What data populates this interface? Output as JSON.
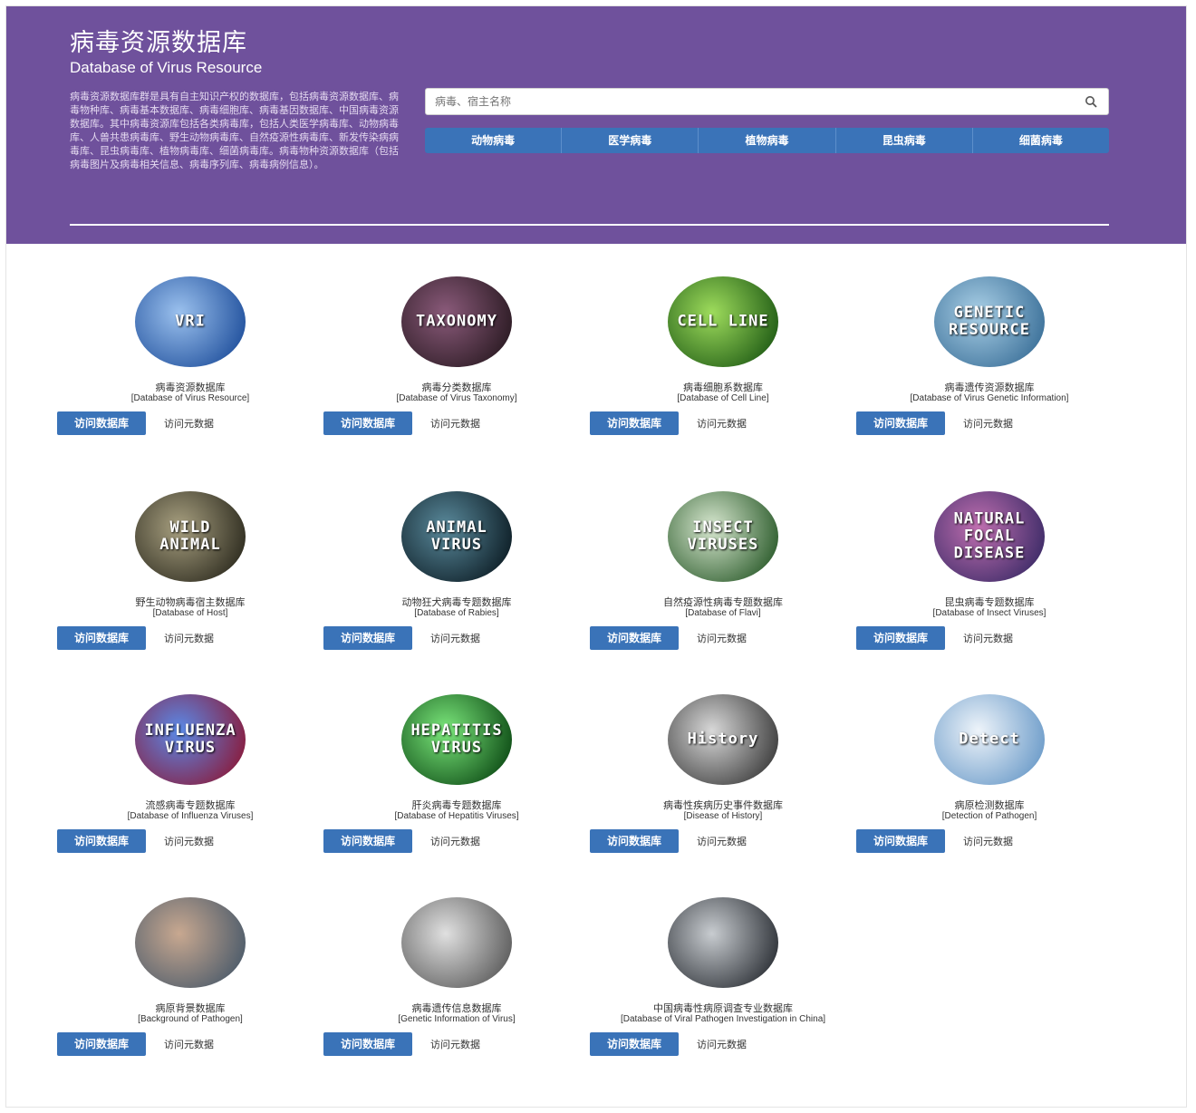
{
  "header": {
    "title_zh": "病毒资源数据库",
    "title_en": "Database of Virus Resource",
    "description": "病毒资源数据库群是具有自主知识产权的数据库，包括病毒资源数据库、病毒物种库、病毒基本数据库、病毒细胞库、病毒基因数据库、中国病毒资源数据库。其中病毒资源库包括各类病毒库，包括人类医学病毒库、动物病毒库、人兽共患病毒库、野生动物病毒库、自然疫源性病毒库、新发传染病病毒库、昆虫病毒库、植物病毒库、细菌病毒库。病毒物种资源数据库（包括病毒图片及病毒相关信息、病毒序列库、病毒病例信息）。"
  },
  "search": {
    "placeholder": "病毒、宿主名称"
  },
  "categories": [
    "动物病毒",
    "医学病毒",
    "植物病毒",
    "昆虫病毒",
    "细菌病毒"
  ],
  "visit_label": "访问数据库",
  "meta_label": "访问元数据",
  "databases": [
    {
      "zh": "病毒资源数据库",
      "en": "[Database of Virus Resource]",
      "img": "VRI",
      "c1": "#9bc1ee",
      "c2": "#1f4f9c"
    },
    {
      "zh": "病毒分类数据库",
      "en": "[Database of Virus Taxonomy]",
      "img": "TAXONOMY",
      "c1": "#8a5a7a",
      "c2": "#2a1a22"
    },
    {
      "zh": "病毒细胞系数据库",
      "en": "[Database of Cell Line]",
      "img": "CELL LINE",
      "c1": "#9edc5c",
      "c2": "#1e5a14"
    },
    {
      "zh": "病毒遗传资源数据库",
      "en": "[Database of Virus Genetic Information]",
      "img": "GENETIC RESOURCE",
      "c1": "#a9cfe6",
      "c2": "#3a6f98"
    },
    {
      "zh": "野生动物病毒宿主数据库",
      "en": "[Database of Host]",
      "img": "WILD ANIMAL",
      "c1": "#a8a080",
      "c2": "#2c2a1e"
    },
    {
      "zh": "动物狂犬病毒专题数据库",
      "en": "[Database of Rabies]",
      "img": "ANIMAL VIRUS",
      "c1": "#5a8a9c",
      "c2": "#0c1c24"
    },
    {
      "zh": "自然疫源性病毒专题数据库",
      "en": "[Database of Flavi]",
      "img": "INSECT VIRUSES",
      "c1": "#d8e8d0",
      "c2": "#2a5a2a"
    },
    {
      "zh": "昆虫病毒专题数据库",
      "en": "[Database of Insect Viruses]",
      "img": "NATURAL FOCAL DISEASE",
      "c1": "#c06fb0",
      "c2": "#3a2a66"
    },
    {
      "zh": "流感病毒专题数据库",
      "en": "[Database of Influenza Viruses]",
      "img": "INFLUENZA VIRUS",
      "c1": "#5a8ae8",
      "c2": "#8a1a3a"
    },
    {
      "zh": "肝炎病毒专题数据库",
      "en": "[Database of Hepatitis Viruses]",
      "img": "HEPATITIS VIRUS",
      "c1": "#7ce87c",
      "c2": "#0c4a14"
    },
    {
      "zh": "病毒性疾病历史事件数据库",
      "en": "[Disease of History]",
      "img": "History",
      "c1": "#d8d8d8",
      "c2": "#3a3a3a"
    },
    {
      "zh": "病原检测数据库",
      "en": "[Detection of Pathogen]",
      "img": "Detect",
      "c1": "#eef4fa",
      "c2": "#6a9ac8"
    },
    {
      "zh": "病原背景数据库",
      "en": "[Background of Pathogen]",
      "img": "",
      "c1": "#c8a890",
      "c2": "#4a5a6a"
    },
    {
      "zh": "病毒遗传信息数据库",
      "en": "[Genetic Information of Virus]",
      "img": "",
      "c1": "#e0e0e0",
      "c2": "#5a5a5a"
    },
    {
      "zh": "中国病毒性病原调查专业数据库",
      "en": "[Database of Viral Pathogen Investigation in China]",
      "img": "",
      "c1": "#c8ccd0",
      "c2": "#2a2e34"
    }
  ]
}
